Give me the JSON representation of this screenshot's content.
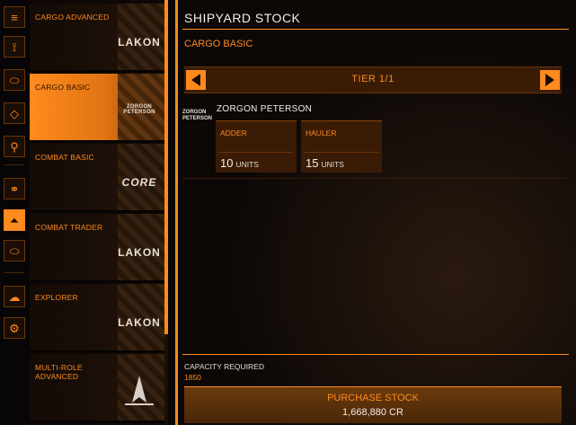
{
  "rail": {
    "icons": [
      "menu-icon",
      "route-icon",
      "tag-icon",
      "tag-alt-icon",
      "person-pin-icon",
      "link-icon",
      "ship-hull-icon",
      "tag-small-icon",
      "cloud-icon",
      "gear-icon"
    ],
    "glyphs": [
      "≡",
      "⟟",
      "⬭",
      "◇",
      "⚲",
      "⚭",
      "⏶",
      "⬭",
      "☁",
      "⚙"
    ]
  },
  "packs": [
    {
      "label": "CARGO ADVANCED",
      "logo": "LAKON",
      "active": false
    },
    {
      "label": "CARGO BASIC",
      "logo": "ZORGON PETERSON",
      "active": true
    },
    {
      "label": "COMBAT BASIC",
      "logo": "CORE",
      "active": false
    },
    {
      "label": "COMBAT TRADER",
      "logo": "LAKON",
      "active": false
    },
    {
      "label": "EXPLORER",
      "logo": "LAKON",
      "active": false
    },
    {
      "label": "MULTI-ROLE ADVANCED",
      "logo": "",
      "active": false
    }
  ],
  "header": {
    "title": "SHIPYARD STOCK",
    "subtitle": "CARGO BASIC"
  },
  "tier": {
    "label": "TIER 1/1"
  },
  "manufacturer": {
    "logo_text": "ZORGON PETERSON",
    "name": "ZORGON PETERSON"
  },
  "ships": [
    {
      "name": "ADDER",
      "qty": "10",
      "unit": "UNITS"
    },
    {
      "name": "HAULER",
      "qty": "15",
      "unit": "UNITS"
    }
  ],
  "capacity": {
    "label": "CAPACITY REQUIRED",
    "value": "1850"
  },
  "purchase": {
    "label": "PURCHASE STOCK",
    "price": "1,668,880 CR"
  },
  "colors": {
    "accent": "#ff8a1e",
    "panel": "#3a1c06",
    "text": "#f2eee8"
  }
}
